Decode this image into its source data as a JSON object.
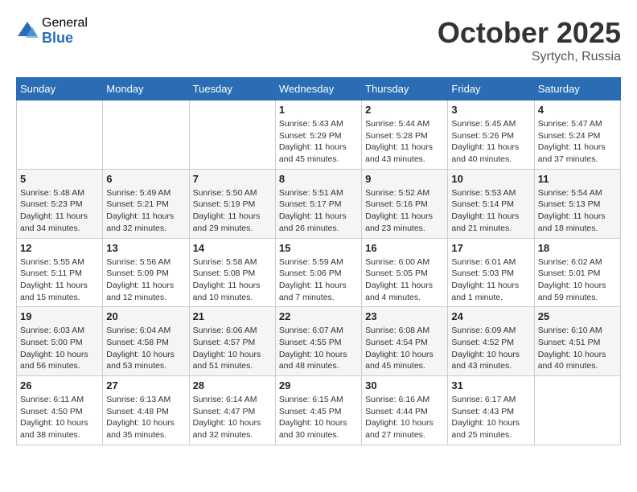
{
  "logo": {
    "general": "General",
    "blue": "Blue",
    "icon_color": "#2a6db5"
  },
  "title": "October 2025",
  "location": "Syrtych, Russia",
  "weekdays": [
    "Sunday",
    "Monday",
    "Tuesday",
    "Wednesday",
    "Thursday",
    "Friday",
    "Saturday"
  ],
  "weeks": [
    [
      {
        "day": "",
        "info": ""
      },
      {
        "day": "",
        "info": ""
      },
      {
        "day": "",
        "info": ""
      },
      {
        "day": "1",
        "info": "Sunrise: 5:43 AM\nSunset: 5:29 PM\nDaylight: 11 hours and 45 minutes."
      },
      {
        "day": "2",
        "info": "Sunrise: 5:44 AM\nSunset: 5:28 PM\nDaylight: 11 hours and 43 minutes."
      },
      {
        "day": "3",
        "info": "Sunrise: 5:45 AM\nSunset: 5:26 PM\nDaylight: 11 hours and 40 minutes."
      },
      {
        "day": "4",
        "info": "Sunrise: 5:47 AM\nSunset: 5:24 PM\nDaylight: 11 hours and 37 minutes."
      }
    ],
    [
      {
        "day": "5",
        "info": "Sunrise: 5:48 AM\nSunset: 5:23 PM\nDaylight: 11 hours and 34 minutes."
      },
      {
        "day": "6",
        "info": "Sunrise: 5:49 AM\nSunset: 5:21 PM\nDaylight: 11 hours and 32 minutes."
      },
      {
        "day": "7",
        "info": "Sunrise: 5:50 AM\nSunset: 5:19 PM\nDaylight: 11 hours and 29 minutes."
      },
      {
        "day": "8",
        "info": "Sunrise: 5:51 AM\nSunset: 5:17 PM\nDaylight: 11 hours and 26 minutes."
      },
      {
        "day": "9",
        "info": "Sunrise: 5:52 AM\nSunset: 5:16 PM\nDaylight: 11 hours and 23 minutes."
      },
      {
        "day": "10",
        "info": "Sunrise: 5:53 AM\nSunset: 5:14 PM\nDaylight: 11 hours and 21 minutes."
      },
      {
        "day": "11",
        "info": "Sunrise: 5:54 AM\nSunset: 5:13 PM\nDaylight: 11 hours and 18 minutes."
      }
    ],
    [
      {
        "day": "12",
        "info": "Sunrise: 5:55 AM\nSunset: 5:11 PM\nDaylight: 11 hours and 15 minutes."
      },
      {
        "day": "13",
        "info": "Sunrise: 5:56 AM\nSunset: 5:09 PM\nDaylight: 11 hours and 12 minutes."
      },
      {
        "day": "14",
        "info": "Sunrise: 5:58 AM\nSunset: 5:08 PM\nDaylight: 11 hours and 10 minutes."
      },
      {
        "day": "15",
        "info": "Sunrise: 5:59 AM\nSunset: 5:06 PM\nDaylight: 11 hours and 7 minutes."
      },
      {
        "day": "16",
        "info": "Sunrise: 6:00 AM\nSunset: 5:05 PM\nDaylight: 11 hours and 4 minutes."
      },
      {
        "day": "17",
        "info": "Sunrise: 6:01 AM\nSunset: 5:03 PM\nDaylight: 11 hours and 1 minute."
      },
      {
        "day": "18",
        "info": "Sunrise: 6:02 AM\nSunset: 5:01 PM\nDaylight: 10 hours and 59 minutes."
      }
    ],
    [
      {
        "day": "19",
        "info": "Sunrise: 6:03 AM\nSunset: 5:00 PM\nDaylight: 10 hours and 56 minutes."
      },
      {
        "day": "20",
        "info": "Sunrise: 6:04 AM\nSunset: 4:58 PM\nDaylight: 10 hours and 53 minutes."
      },
      {
        "day": "21",
        "info": "Sunrise: 6:06 AM\nSunset: 4:57 PM\nDaylight: 10 hours and 51 minutes."
      },
      {
        "day": "22",
        "info": "Sunrise: 6:07 AM\nSunset: 4:55 PM\nDaylight: 10 hours and 48 minutes."
      },
      {
        "day": "23",
        "info": "Sunrise: 6:08 AM\nSunset: 4:54 PM\nDaylight: 10 hours and 45 minutes."
      },
      {
        "day": "24",
        "info": "Sunrise: 6:09 AM\nSunset: 4:52 PM\nDaylight: 10 hours and 43 minutes."
      },
      {
        "day": "25",
        "info": "Sunrise: 6:10 AM\nSunset: 4:51 PM\nDaylight: 10 hours and 40 minutes."
      }
    ],
    [
      {
        "day": "26",
        "info": "Sunrise: 6:11 AM\nSunset: 4:50 PM\nDaylight: 10 hours and 38 minutes."
      },
      {
        "day": "27",
        "info": "Sunrise: 6:13 AM\nSunset: 4:48 PM\nDaylight: 10 hours and 35 minutes."
      },
      {
        "day": "28",
        "info": "Sunrise: 6:14 AM\nSunset: 4:47 PM\nDaylight: 10 hours and 32 minutes."
      },
      {
        "day": "29",
        "info": "Sunrise: 6:15 AM\nSunset: 4:45 PM\nDaylight: 10 hours and 30 minutes."
      },
      {
        "day": "30",
        "info": "Sunrise: 6:16 AM\nSunset: 4:44 PM\nDaylight: 10 hours and 27 minutes."
      },
      {
        "day": "31",
        "info": "Sunrise: 6:17 AM\nSunset: 4:43 PM\nDaylight: 10 hours and 25 minutes."
      },
      {
        "day": "",
        "info": ""
      }
    ]
  ]
}
